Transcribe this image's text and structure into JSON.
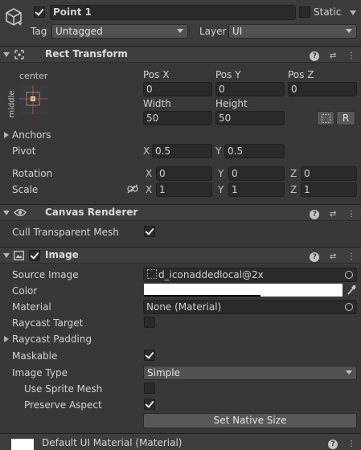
{
  "gameobject": {
    "active": true,
    "name": "Point 1",
    "static_label": "Static",
    "static_checked": false,
    "tag_label": "Tag",
    "tag_value": "Untagged",
    "layer_label": "Layer",
    "layer_value": "UI"
  },
  "rect_transform": {
    "title": "Rect Transform",
    "anchor_preset_h": "center",
    "anchor_preset_v": "middle",
    "pos_x_label": "Pos X",
    "pos_y_label": "Pos Y",
    "pos_z_label": "Pos Z",
    "pos_x": "0",
    "pos_y": "0",
    "pos_z": "0",
    "width_label": "Width",
    "height_label": "Height",
    "width": "50",
    "height": "50",
    "raw_button": "R",
    "anchors_label": "Anchors",
    "pivot_label": "Pivot",
    "pivot_x": "0.5",
    "pivot_y": "0.5",
    "rotation_label": "Rotation",
    "rot_x": "0",
    "rot_y": "0",
    "rot_z": "0",
    "scale_label": "Scale",
    "scale_x": "1",
    "scale_y": "1",
    "scale_z": "1",
    "x": "X",
    "y": "Y",
    "z": "Z"
  },
  "canvas_renderer": {
    "title": "Canvas Renderer",
    "cull_label": "Cull Transparent Mesh",
    "cull_checked": true
  },
  "image": {
    "title": "Image",
    "enabled": true,
    "source_image_label": "Source Image",
    "source_image": "d_iconaddedlocal@2x",
    "color_label": "Color",
    "color_value": "#FFFFFF",
    "material_label": "Material",
    "material": "None (Material)",
    "raycast_target_label": "Raycast Target",
    "raycast_target": false,
    "raycast_padding_label": "Raycast Padding",
    "maskable_label": "Maskable",
    "maskable": true,
    "image_type_label": "Image Type",
    "image_type": "Simple",
    "use_sprite_mesh_label": "Use Sprite Mesh",
    "use_sprite_mesh": false,
    "preserve_aspect_label": "Preserve Aspect",
    "preserve_aspect": true,
    "set_native_size": "Set Native Size"
  },
  "material_footer": {
    "title": "Default UI Material (Material)"
  }
}
